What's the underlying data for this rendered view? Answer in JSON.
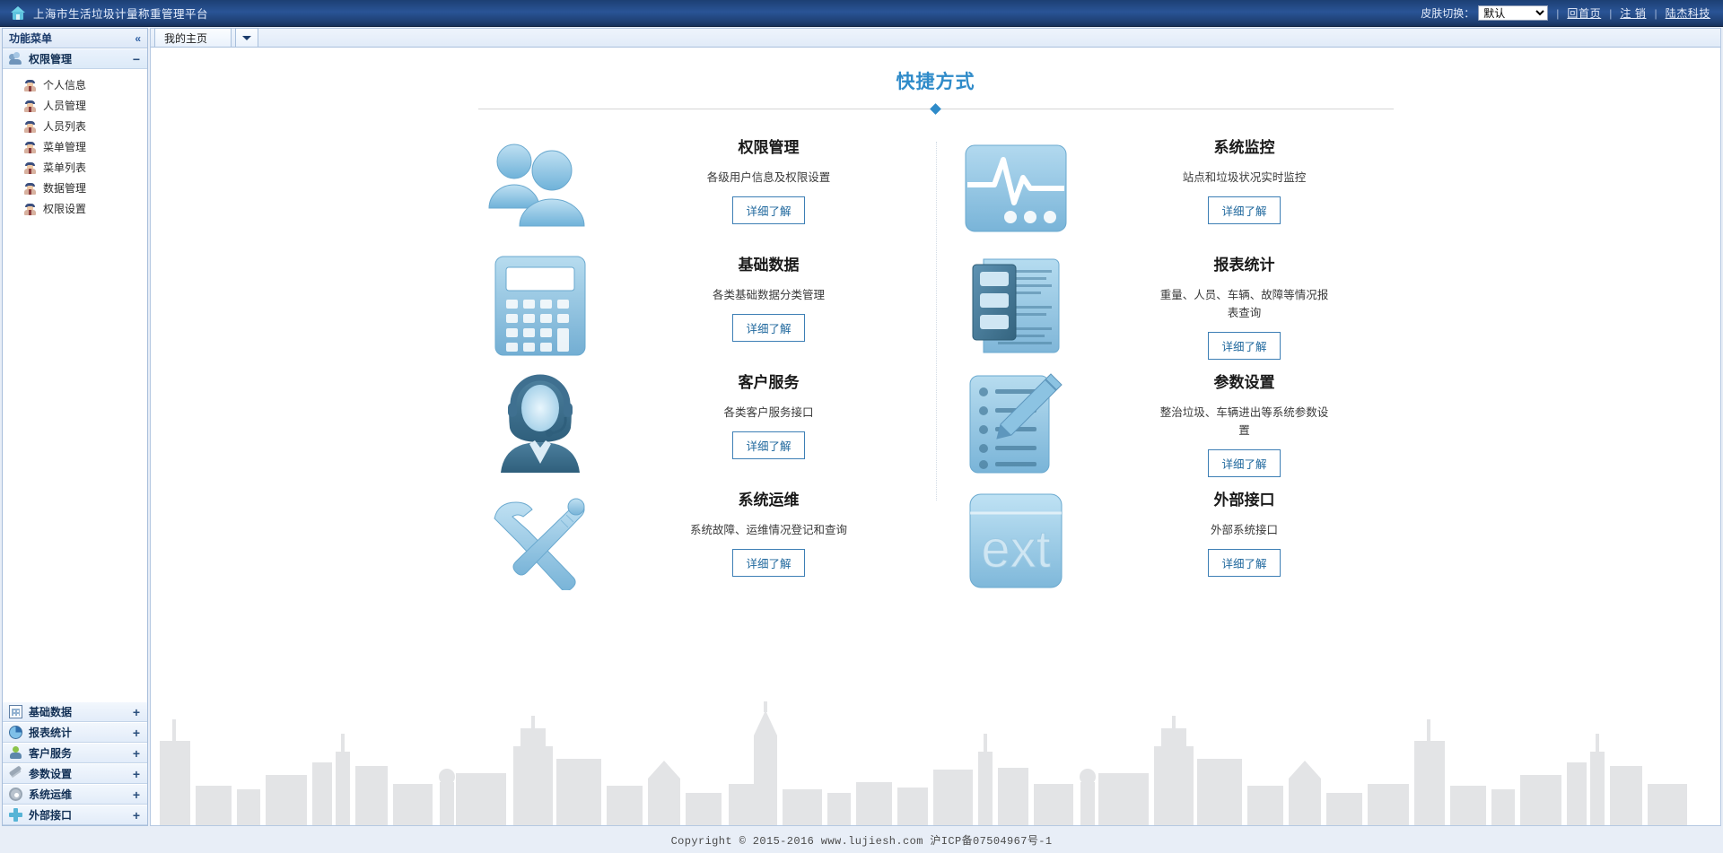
{
  "header": {
    "home_icon": "home-icon",
    "title": "上海市生活垃圾计量称重管理平台",
    "skin_label": "皮肤切换：",
    "skin_value": "默认",
    "skin_options": [
      "默认"
    ],
    "links": [
      {
        "label": "回首页"
      },
      {
        "label": "注 销"
      },
      {
        "label": "陆杰科技"
      }
    ],
    "separator": "|"
  },
  "sidebar": {
    "panel_title": "功能菜单",
    "collapse_icon": "«",
    "active_group": {
      "label": "权限管理",
      "icon": "users-icon",
      "toggle": "−",
      "items": [
        {
          "label": "个人信息",
          "icon": "person-icon"
        },
        {
          "label": "人员管理",
          "icon": "person-icon"
        },
        {
          "label": "人员列表",
          "icon": "person-icon"
        },
        {
          "label": "菜单管理",
          "icon": "person-icon"
        },
        {
          "label": "菜单列表",
          "icon": "person-icon"
        },
        {
          "label": "数据管理",
          "icon": "person-icon"
        },
        {
          "label": "权限设置",
          "icon": "person-icon"
        }
      ]
    },
    "groups": [
      {
        "label": "基础数据",
        "icon": "grid-icon",
        "toggle": "+"
      },
      {
        "label": "报表统计",
        "icon": "pie-icon",
        "toggle": "+"
      },
      {
        "label": "客户服务",
        "icon": "headset-icon",
        "toggle": "+"
      },
      {
        "label": "参数设置",
        "icon": "wrench-icon",
        "toggle": "+"
      },
      {
        "label": "系统运维",
        "icon": "gear-icon",
        "toggle": "+"
      },
      {
        "label": "外部接口",
        "icon": "plus-icon",
        "toggle": "+"
      }
    ]
  },
  "tabbar": {
    "tabs": [
      {
        "label": "我的主页"
      }
    ],
    "dropdown_icon": "chevron-down-icon"
  },
  "content": {
    "title": "快捷方式",
    "button_label": "详细了解",
    "left_cards": [
      {
        "icon": "users-art",
        "title": "权限管理",
        "desc": "各级用户信息及权限设置"
      },
      {
        "icon": "calculator-art",
        "title": "基础数据",
        "desc": "各类基础数据分类管理"
      },
      {
        "icon": "agent-art",
        "title": "客户服务",
        "desc": "各类客户服务接口"
      },
      {
        "icon": "tools-art",
        "title": "系统运维",
        "desc": "系统故障、运维情况登记和查询"
      }
    ],
    "right_cards": [
      {
        "icon": "monitor-art",
        "title": "系统监控",
        "desc": "站点和垃圾状况实时监控"
      },
      {
        "icon": "report-art",
        "title": "报表统计",
        "desc": "重量、人员、车辆、故障等情况报表查询"
      },
      {
        "icon": "settings-art",
        "title": "参数设置",
        "desc": "整治垃圾、车辆进出等系统参数设置"
      },
      {
        "icon": "ext-art",
        "title": "外部接口",
        "desc": "外部系统接口"
      }
    ]
  },
  "footer": {
    "copyright": "Copyright © 2015-2016 www.lujiesh.com 沪ICP备07504967号-1"
  },
  "colors": {
    "header_blue": "#2a5496",
    "accent_blue": "#2f8bc9",
    "button_border": "#3d7fb5",
    "icon_blue": "#8fc4e3"
  }
}
